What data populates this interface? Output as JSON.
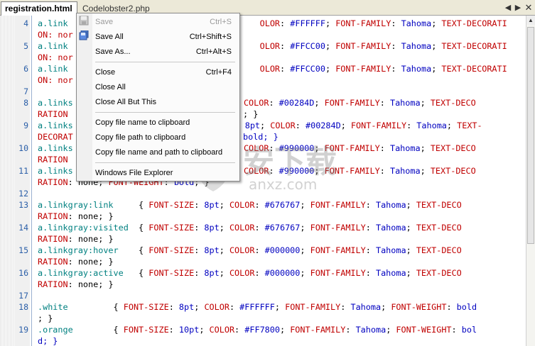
{
  "tabs": {
    "active": "registration.html",
    "inactive": "Codelobster2.php"
  },
  "menu": {
    "items": [
      {
        "label": "Save",
        "shortcut": "Ctrl+S",
        "disabled": true
      },
      {
        "label": "Save All",
        "shortcut": "Ctrl+Shift+S",
        "disabled": false
      },
      {
        "label": "Save As...",
        "shortcut": "Ctrl+Alt+S",
        "disabled": false
      },
      {
        "label": "Close",
        "shortcut": "Ctrl+F4",
        "disabled": false
      },
      {
        "label": "Close All",
        "shortcut": "",
        "disabled": false
      },
      {
        "label": "Close All But This",
        "shortcut": "",
        "disabled": false
      },
      {
        "label": "Copy file name to clipboard",
        "shortcut": "",
        "disabled": false
      },
      {
        "label": "Copy file path to clipboard",
        "shortcut": "",
        "disabled": false
      },
      {
        "label": "Copy file name and path to clipboard",
        "shortcut": "",
        "disabled": false
      },
      {
        "label": "Windows File Explorer",
        "shortcut": "",
        "disabled": false
      }
    ]
  },
  "gutter": {
    "numbers": [
      "4",
      "5",
      "6",
      "7",
      "8",
      "9",
      "10",
      "11",
      "12",
      "13",
      "14",
      "15",
      "16",
      "17",
      "18",
      "19"
    ]
  },
  "code": {
    "l4a": [
      "a.link",
      "",
      "OLOR",
      ": ",
      "#FFFFFF",
      "; ",
      "FONT-FAMILY",
      ": ",
      "Tahoma",
      "; ",
      "TEXT-DECORATI"
    ],
    "l4b": "ON: nor",
    "l5a": [
      "a.link",
      "",
      "OLOR",
      ": ",
      "#FFCC00",
      "; ",
      "FONT-FAMILY",
      ": ",
      "Tahoma",
      "; ",
      "TEXT-DECORATI"
    ],
    "l5b": "ON: nor",
    "l6a": [
      "a.link",
      "",
      "OLOR",
      ": ",
      "#FFCC00",
      "; ",
      "FONT-FAMILY",
      ": ",
      "Tahoma",
      "; ",
      "TEXT-DECORATI"
    ],
    "l6b": "ON: nor",
    "l8a": [
      "a.links",
      "; ",
      "COLOR",
      ": ",
      "#00284D",
      "; ",
      "FONT-FAMILY",
      ": ",
      "Tahoma",
      "; ",
      "TEXT-DECO"
    ],
    "l8b": "RATION",
    "l8c": "; }",
    "l9a": [
      "a.links",
      "",
      "8pt",
      ": ",
      "COLOR",
      ": ",
      "#00284D",
      "; ",
      "FONT-FAMILY",
      ": ",
      "Tahoma",
      "; ",
      "TEXT-"
    ],
    "l9b": "DECORAT",
    "l9c": "bold; }",
    "l10a": [
      "a.links",
      "; ",
      "COLOR",
      ": ",
      "#990000",
      "; ",
      "FONT-FAMILY",
      ": ",
      "Tahoma",
      "; ",
      "TEXT-DECO"
    ],
    "l10b": "RATION",
    "l11a": [
      "a.links",
      "; ",
      "COLOR",
      ": ",
      "#990000",
      "; ",
      "FONT-FAMILY",
      ": ",
      "Tahoma",
      "; ",
      "TEXT-DECO"
    ],
    "l11b": [
      "RATION",
      ": none; ",
      "FONT-WEIGHT",
      ": ",
      "bold",
      "; }"
    ],
    "l13a": [
      "a.linkgray:link",
      "     { ",
      "FONT-SIZE",
      ": ",
      "8pt",
      "; ",
      "COLOR",
      ": ",
      "#676767",
      "; ",
      "FONT-FAMILY",
      ": ",
      "Tahoma",
      "; ",
      "TEXT-DECO"
    ],
    "l13b": [
      "RATION",
      ": none; }"
    ],
    "l14a": [
      "a.linkgray:visited",
      "  { ",
      "FONT-SIZE",
      ": ",
      "8pt",
      "; ",
      "COLOR",
      ": ",
      "#676767",
      "; ",
      "FONT-FAMILY",
      ": ",
      "Tahoma",
      "; ",
      "TEXT-DECO"
    ],
    "l14b": [
      "RATION",
      ": none; }"
    ],
    "l15a": [
      "a.linkgray:hover",
      "    { ",
      "FONT-SIZE",
      ": ",
      "8pt",
      "; ",
      "COLOR",
      ": ",
      "#000000",
      "; ",
      "FONT-FAMILY",
      ": ",
      "Tahoma",
      "; ",
      "TEXT-DECO"
    ],
    "l15b": [
      "RATION",
      ": none; }"
    ],
    "l16a": [
      "a.linkgray:active",
      "   { ",
      "FONT-SIZE",
      ": ",
      "8pt",
      "; ",
      "COLOR",
      ": ",
      "#000000",
      "; ",
      "FONT-FAMILY",
      ": ",
      "Tahoma",
      "; ",
      "TEXT-DECO"
    ],
    "l16b": [
      "RATION",
      ": none; }"
    ],
    "l18a": [
      ".white",
      "         { ",
      "FONT-SIZE",
      ": ",
      "8pt",
      "; ",
      "COLOR",
      ": ",
      "#FFFFFF",
      "; ",
      "FONT-FAMILY",
      ": ",
      "Tahoma",
      "; ",
      "FONT-WEIGHT",
      ": ",
      "bold"
    ],
    "l18b": "; }",
    "l19a": [
      ".orange",
      "        { ",
      "FONT-SIZE",
      ": ",
      "10pt",
      "; ",
      "COLOR",
      ": ",
      "#FF7800",
      "; ",
      "FONT-FAMILY",
      ": ",
      "Tahoma",
      "; ",
      "FONT-WEIGHT",
      ": ",
      "bol"
    ],
    "l19b": "d; }"
  },
  "watermark": {
    "text": "安下载",
    "sub": "anxz.com"
  },
  "icons": {
    "tab_prev": "chevron-left-icon",
    "tab_next": "chevron-right-icon",
    "tab_close": "close-icon"
  }
}
